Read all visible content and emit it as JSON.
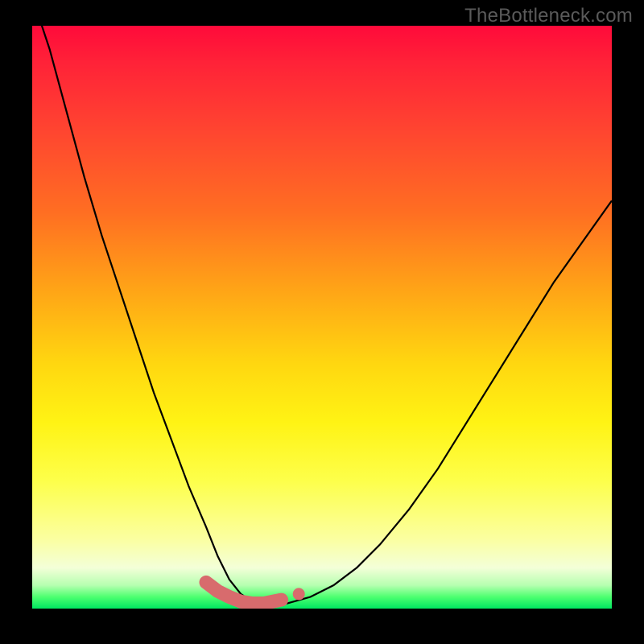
{
  "watermark": "TheBottleneck.com",
  "colors": {
    "frame_bg": "#000000",
    "watermark": "#5a5a5a",
    "curve": "#000000",
    "valley": "#d86b6d"
  },
  "chart_data": {
    "type": "line",
    "title": "",
    "xlabel": "",
    "ylabel": "",
    "xlim": [
      0,
      100
    ],
    "ylim": [
      0,
      100
    ],
    "note": "Bottleneck risk curve shown over a vertical heat gradient (red=100% at top → green=0% at bottom). Thick salmon segment marks the near-zero-bottleneck optimal region.",
    "series": [
      {
        "name": "bottleneck_pct",
        "x": [
          0,
          3,
          6,
          9,
          12,
          15,
          18,
          21,
          24,
          27,
          30,
          32,
          34,
          36,
          38,
          40,
          44,
          48,
          52,
          56,
          60,
          65,
          70,
          75,
          80,
          85,
          90,
          95,
          100
        ],
        "y": [
          105,
          96,
          85,
          74,
          64,
          55,
          46,
          37,
          29,
          21,
          14,
          9,
          5,
          2.5,
          1.2,
          0.6,
          0.9,
          2.0,
          4.0,
          7.0,
          11,
          17,
          24,
          32,
          40,
          48,
          56,
          63,
          70
        ]
      }
    ],
    "highlight": {
      "name": "optimal_range",
      "x": [
        30,
        32,
        34,
        36,
        38,
        40,
        43
      ],
      "y": [
        4.5,
        3.0,
        2.0,
        1.2,
        0.9,
        0.9,
        1.5
      ],
      "detached_dot": {
        "x": 46,
        "y": 2.5
      }
    },
    "background": {
      "type": "vertical_gradient",
      "stops": [
        {
          "pct": 0,
          "color": "#ff0a3a"
        },
        {
          "pct": 32,
          "color": "#ff6e22"
        },
        {
          "pct": 58,
          "color": "#ffd710"
        },
        {
          "pct": 88,
          "color": "#fbffa0"
        },
        {
          "pct": 100,
          "color": "#00e760"
        }
      ]
    }
  }
}
